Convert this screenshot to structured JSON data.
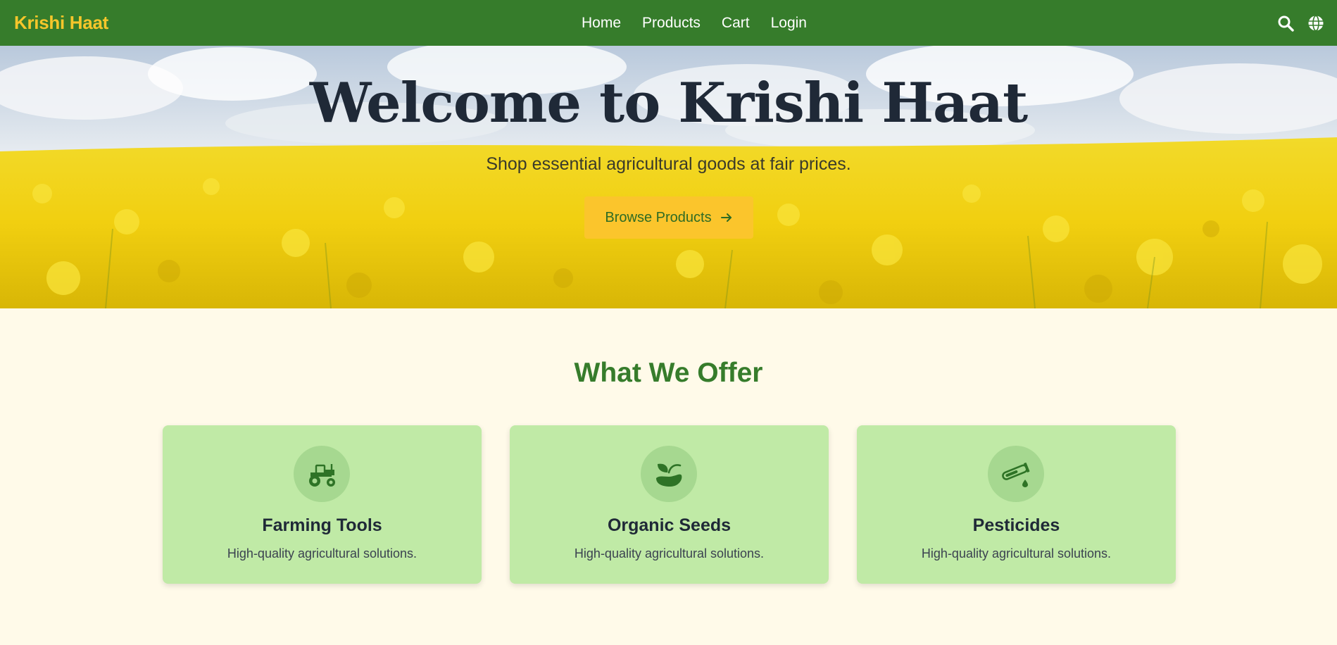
{
  "nav": {
    "brand": "Krishi Haat",
    "links": [
      "Home",
      "Products",
      "Cart",
      "Login"
    ],
    "icons": [
      "search-icon",
      "globe-icon"
    ]
  },
  "hero": {
    "title": "Welcome to Krishi Haat",
    "subtitle": "Shop essential agricultural goods at fair prices.",
    "button_label": "Browse Products",
    "button_icon": "arrow-right-icon"
  },
  "offer": {
    "title": "What We Offer",
    "cards": [
      {
        "title": "Farming Tools",
        "description": "High-quality agricultural solutions.",
        "icon": "tractor-icon"
      },
      {
        "title": "Organic Seeds",
        "description": "High-quality agricultural solutions.",
        "icon": "seedling-icon"
      },
      {
        "title": "Pesticides",
        "description": "High-quality agricultural solutions.",
        "icon": "test-tube-drop-icon"
      }
    ]
  },
  "colors": {
    "nav_bg": "#367c2b",
    "brand": "#f6c62b",
    "page_bg": "#fffae9",
    "button_bg": "#fbc52c",
    "card_bg": "#c0eaa6",
    "accent_green": "#367c2b"
  }
}
